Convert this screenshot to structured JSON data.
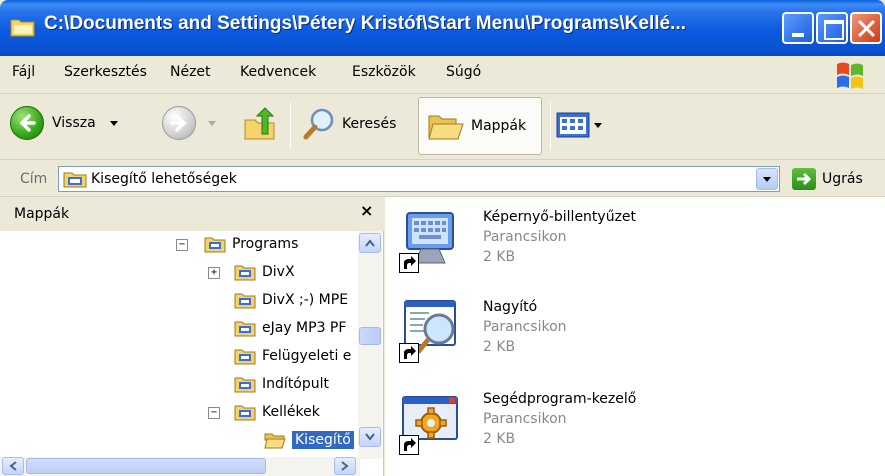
{
  "window": {
    "title": "C:\\Documents and Settings\\Pétery Kristóf\\Start Menu\\Programs\\Kellé..."
  },
  "menu": [
    "Fájl",
    "Szerkesztés",
    "Nézet",
    "Kedvencek",
    "Eszközök",
    "Súgó"
  ],
  "toolbar": {
    "back_label": "Vissza",
    "search_label": "Keresés",
    "folders_label": "Mappák"
  },
  "address": {
    "label": "Cím",
    "value": "Kisegítő lehetőségek",
    "go_label": "Ugrás"
  },
  "folders_pane": {
    "title": "Mappák",
    "close_glyph": "×",
    "tree": [
      {
        "label": "Programs",
        "expander": "−"
      },
      {
        "label": "DivX",
        "expander": "+"
      },
      {
        "label": "DivX ;-) MPE",
        "expander": ""
      },
      {
        "label": "eJay MP3 PF",
        "expander": ""
      },
      {
        "label": "Felügyeleti e",
        "expander": ""
      },
      {
        "label": "Indítópult",
        "expander": ""
      },
      {
        "label": "Kellékek",
        "expander": "−"
      },
      {
        "label": "Kisegítő",
        "expander": "",
        "selected": true
      }
    ]
  },
  "files": [
    {
      "name": "Képernyő-billentyűzet",
      "type": "Parancsikon",
      "size": "2 KB",
      "icon": "on-screen-keyboard-icon"
    },
    {
      "name": "Nagyító",
      "type": "Parancsikon",
      "size": "2 KB",
      "icon": "magnifier-icon"
    },
    {
      "name": "Segédprogram-kezelő",
      "type": "Parancsikon",
      "size": "2 KB",
      "icon": "utility-manager-icon"
    }
  ],
  "colors": {
    "titlebar": "#0a52d0",
    "selection": "#316ac5",
    "window_bg": "#ece9d8"
  }
}
